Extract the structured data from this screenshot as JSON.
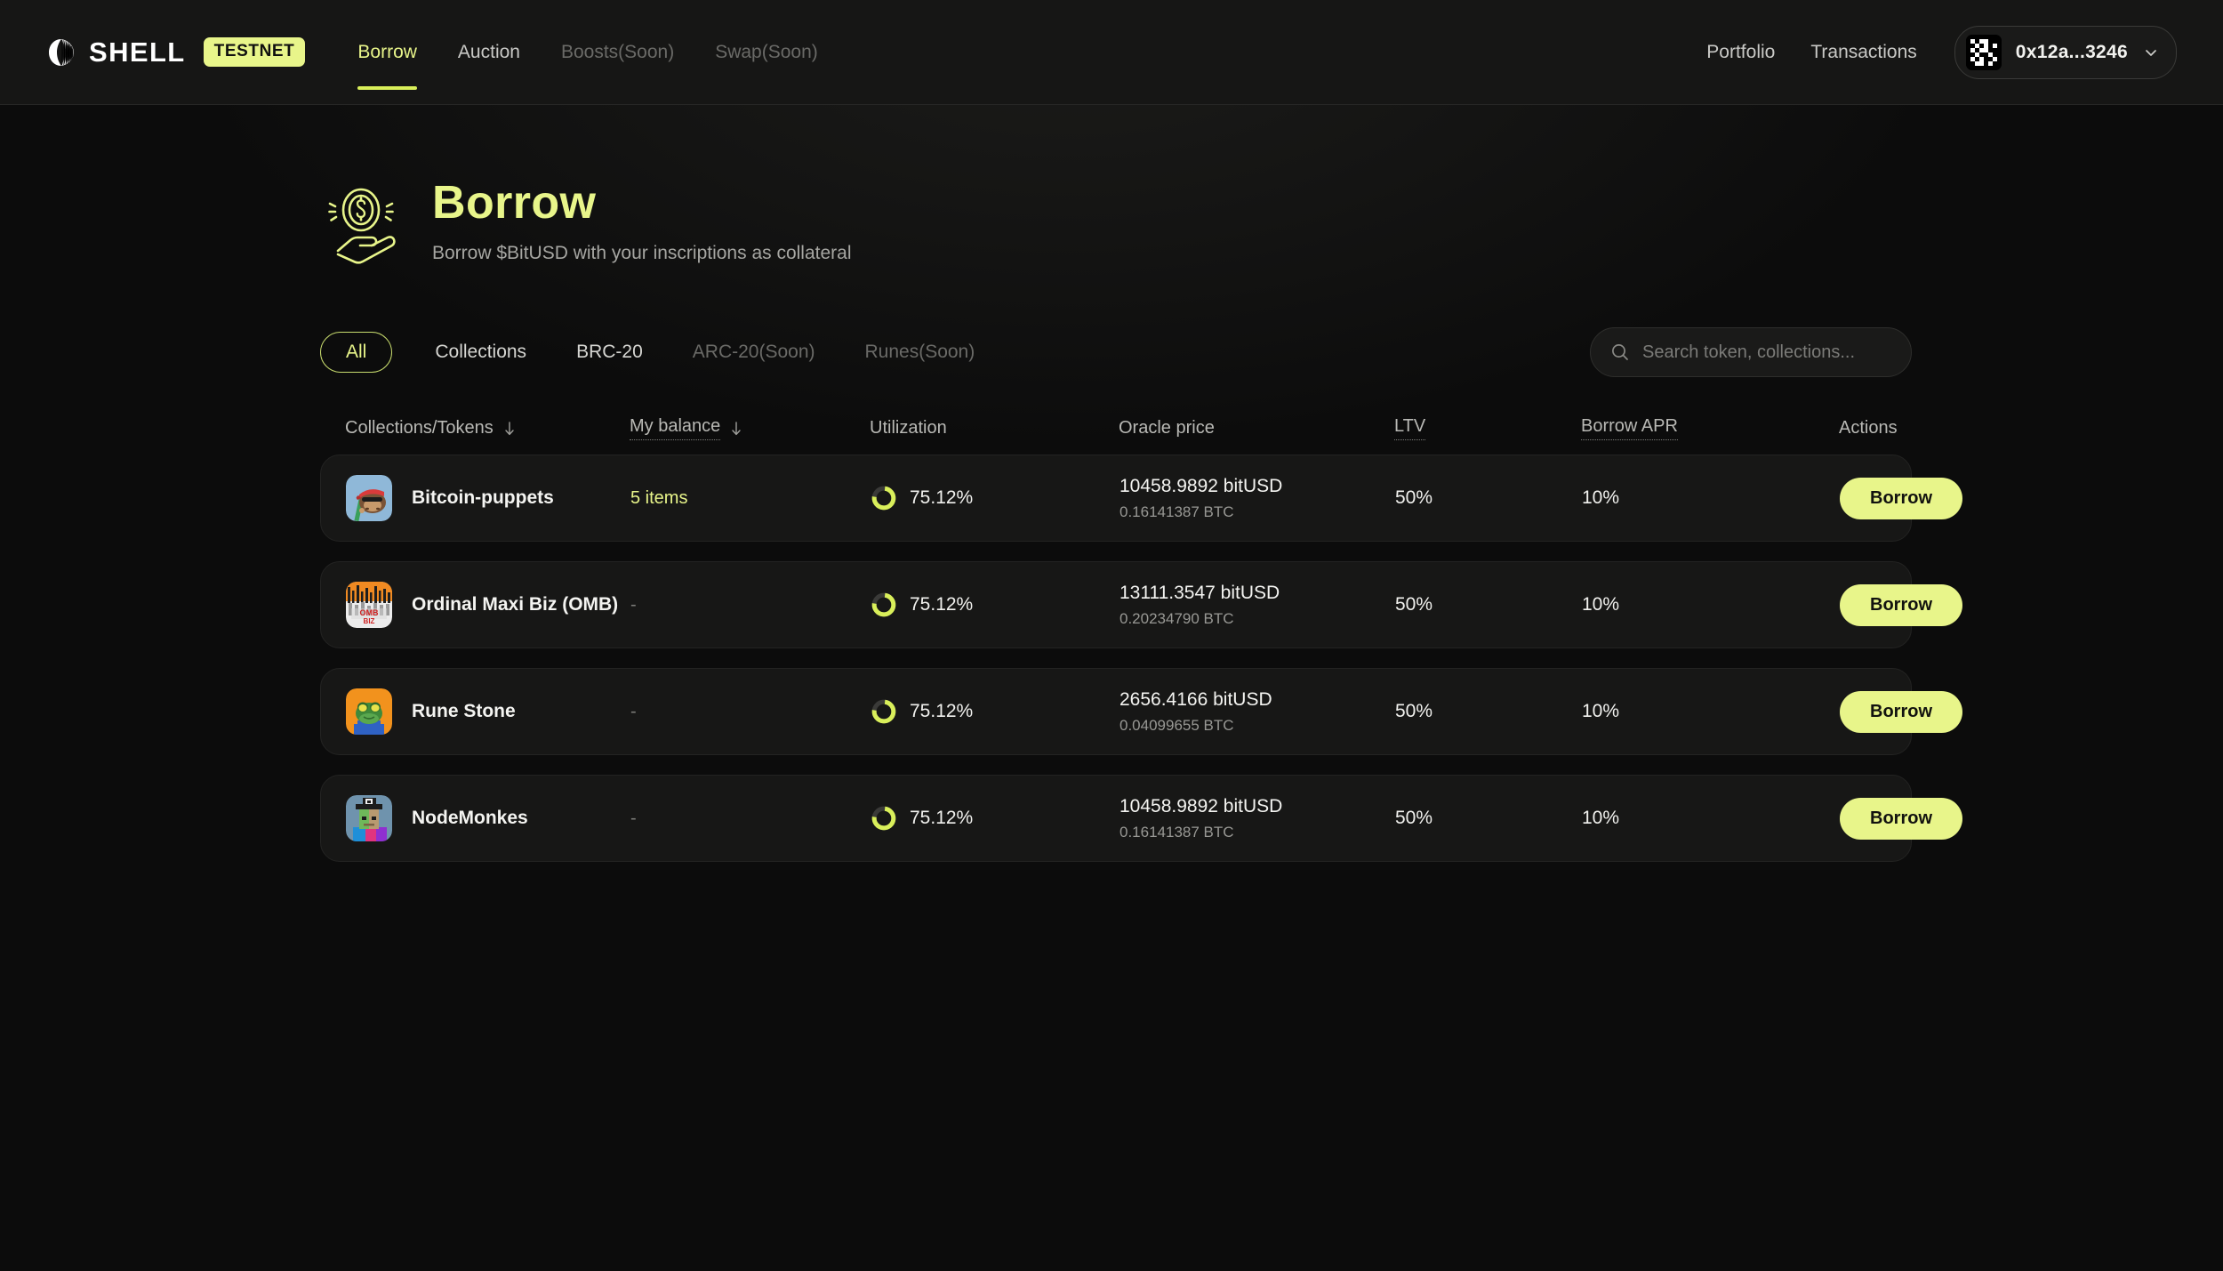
{
  "header": {
    "brand_name": "SHELL",
    "brand_badge": "TESTNET",
    "logo_icon": "shell-logo-icon",
    "nav": [
      {
        "label": "Borrow",
        "state": "active"
      },
      {
        "label": "Auction",
        "state": "default"
      },
      {
        "label": "Boosts(Soon)",
        "state": "muted"
      },
      {
        "label": "Swap(Soon)",
        "state": "muted"
      }
    ],
    "links": [
      {
        "label": "Portfolio"
      },
      {
        "label": "Transactions"
      }
    ],
    "wallet": {
      "address": "0x12a...3246",
      "avatar_icon": "blockies-avatar-icon",
      "chevron_icon": "chevron-down-icon"
    }
  },
  "hero": {
    "icon": "hand-holding-coin-icon",
    "title": "Borrow",
    "subtitle": "Borrow $BitUSD with your inscriptions as collateral"
  },
  "filters": {
    "tabs": [
      {
        "label": "All",
        "state": "selected"
      },
      {
        "label": "Collections",
        "state": "default"
      },
      {
        "label": "BRC-20",
        "state": "default"
      },
      {
        "label": "ARC-20(Soon)",
        "state": "muted"
      },
      {
        "label": "Runes(Soon)",
        "state": "muted"
      }
    ],
    "search": {
      "placeholder": "Search token, collections...",
      "value": "",
      "icon": "search-icon"
    }
  },
  "table": {
    "columns": [
      {
        "label": "Collections/Tokens",
        "sortable": true,
        "dotted": false
      },
      {
        "label": "My balance",
        "sortable": true,
        "dotted": true
      },
      {
        "label": "Utilization",
        "sortable": false,
        "dotted": false
      },
      {
        "label": "Oracle price",
        "sortable": false,
        "dotted": false
      },
      {
        "label": "LTV",
        "sortable": false,
        "dotted": true
      },
      {
        "label": "Borrow APR",
        "sortable": false,
        "dotted": true
      },
      {
        "label": "Actions",
        "sortable": false,
        "dotted": false
      }
    ],
    "rows": [
      {
        "avatar": "bitcoin-puppets-avatar",
        "name": "Bitcoin-puppets",
        "balance": "5 items",
        "balance_empty": false,
        "utilization": "75.12%",
        "utilization_pct": 75.12,
        "price_usd": "10458.9892 bitUSD",
        "price_btc": "0.16141387 BTC",
        "ltv": "50%",
        "apr": "10%",
        "action": "Borrow"
      },
      {
        "avatar": "ordinal-maxi-biz-avatar",
        "name": "Ordinal Maxi Biz (OMB)",
        "balance": "-",
        "balance_empty": true,
        "utilization": "75.12%",
        "utilization_pct": 75.12,
        "price_usd": "13111.3547 bitUSD",
        "price_btc": "0.20234790 BTC",
        "ltv": "50%",
        "apr": "10%",
        "action": "Borrow"
      },
      {
        "avatar": "rune-stone-avatar",
        "name": "Rune Stone",
        "balance": "-",
        "balance_empty": true,
        "utilization": "75.12%",
        "utilization_pct": 75.12,
        "price_usd": "2656.4166 bitUSD",
        "price_btc": "0.04099655 BTC",
        "ltv": "50%",
        "apr": "10%",
        "action": "Borrow"
      },
      {
        "avatar": "nodemonkes-avatar",
        "name": "NodeMonkes",
        "balance": "-",
        "balance_empty": true,
        "utilization": "75.12%",
        "utilization_pct": 75.12,
        "price_usd": "10458.9892 bitUSD",
        "price_btc": "0.16141387 BTC",
        "ltv": "50%",
        "apr": "10%",
        "action": "Borrow"
      }
    ]
  },
  "colors": {
    "accent": "#e8f58a",
    "accent_strong": "#d9ef5a",
    "page_bg": "#0c0c0c",
    "row_bg": "#171716",
    "header_bg": "#161615",
    "text_primary": "#f4f4f1",
    "text_muted": "#7c7c78"
  }
}
